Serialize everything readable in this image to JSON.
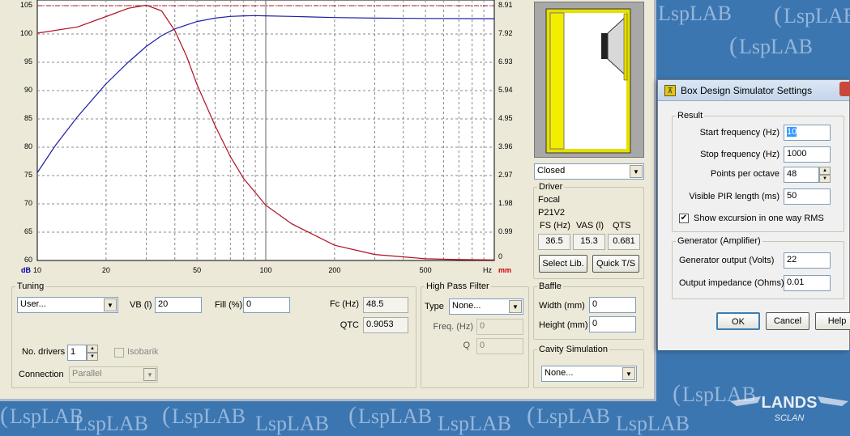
{
  "watermark": "LspLAB",
  "bottom_logo": {
    "brand": "LANDS",
    "sub": "SCLAN"
  },
  "chart_data": {
    "type": "line",
    "x_axis": {
      "scale": "log",
      "range": [
        10,
        1000
      ],
      "tick_labels": [
        "10",
        "20",
        "50",
        "100",
        "200",
        "500"
      ],
      "unit": "Hz"
    },
    "y_left": {
      "range": [
        60,
        106
      ],
      "tick_labels": [
        "105",
        "100",
        "95",
        "90",
        "85",
        "80",
        "75",
        "70",
        "65",
        "60"
      ],
      "unit": "dB"
    },
    "y_right": {
      "range": [
        0,
        9.1
      ],
      "tick_labels": [
        "8.91",
        "7.92",
        "6.93",
        "5.94",
        "4.95",
        "3.96",
        "2.97",
        "1.98",
        "0.99",
        "0"
      ],
      "unit": "mm"
    },
    "grid": true,
    "reference_line_db": 105,
    "cursor_hz": 100,
    "series": [
      {
        "axis": "left",
        "color": "#1c1ca8",
        "x": [
          10,
          12,
          15,
          20,
          25,
          30,
          35,
          40,
          50,
          60,
          70,
          80,
          90,
          100,
          130,
          200,
          300,
          500,
          1000
        ],
        "y": [
          75.5,
          80.3,
          85.4,
          91.2,
          95.0,
          97.8,
          99.7,
          100.9,
          102.2,
          102.8,
          103.1,
          103.2,
          103.25,
          103.2,
          103.1,
          102.9,
          102.8,
          102.75,
          102.7
        ]
      },
      {
        "axis": "right",
        "color": "#b01020",
        "x": [
          10,
          15,
          20,
          25,
          30,
          35,
          40,
          45,
          50,
          60,
          70,
          80,
          100,
          130,
          200,
          300,
          500,
          700,
          1000
        ],
        "y": [
          7.94,
          8.16,
          8.52,
          8.81,
          8.92,
          8.72,
          8.03,
          7.14,
          6.15,
          4.71,
          3.63,
          2.86,
          1.93,
          1.28,
          0.53,
          0.21,
          0.06,
          0.03,
          0.02
        ]
      }
    ]
  },
  "box_type": {
    "selected": "Closed"
  },
  "driver": {
    "title": "Driver",
    "brand": "Focal",
    "model": "P21V2",
    "params": [
      {
        "label": "FS (Hz)",
        "value": "36.5"
      },
      {
        "label": "VAS (l)",
        "value": "15.3"
      },
      {
        "label": "QTS",
        "value": "0.681"
      }
    ],
    "select_label": "Select Lib.",
    "quick_label": "Quick T/S"
  },
  "tuning": {
    "title": "Tuning",
    "preset": "User...",
    "vb_label": "VB (l)",
    "vb": "20",
    "fill_label": "Fill (%)",
    "fill": "0",
    "fc_label": "Fc (Hz)",
    "fc": "48.5",
    "qtc_label": "QTC",
    "qtc": "0.9053",
    "drivers_label": "No. drivers",
    "drivers": "1",
    "isobarik_label": "Isobarik",
    "connection_label": "Connection",
    "connection": "Parallel"
  },
  "hpf": {
    "title": "High Pass Filter",
    "type_label": "Type",
    "type": "None...",
    "freq_label": "Freq. (Hz)",
    "freq": "0",
    "q_label": "Q",
    "q": "0"
  },
  "baffle": {
    "title": "Baffle",
    "width_label": "Width (mm)",
    "width": "0",
    "height_label": "Height (mm)",
    "height": "0"
  },
  "cavity": {
    "title": "Cavity Simulation",
    "value": "None..."
  },
  "dialog": {
    "title": "Box Design Simulator Settings",
    "result_title": "Result",
    "start_label": "Start frequency (Hz)",
    "start": "10",
    "stop_label": "Stop frequency (Hz)",
    "stop": "1000",
    "ppo_label": "Points per octave",
    "ppo": "48",
    "pir_label": "Visible PIR length (ms)",
    "pir": "50",
    "excursion_label": "Show excursion in one way RMS",
    "generator_title": "Generator (Amplifier)",
    "genout_label": "Generator output (Volts)",
    "genout": "22",
    "outimp_label": "Output impedance (Ohms)",
    "outimp": "0.01",
    "ok_label": "OK",
    "cancel_label": "Cancel",
    "help_label": "Help"
  }
}
